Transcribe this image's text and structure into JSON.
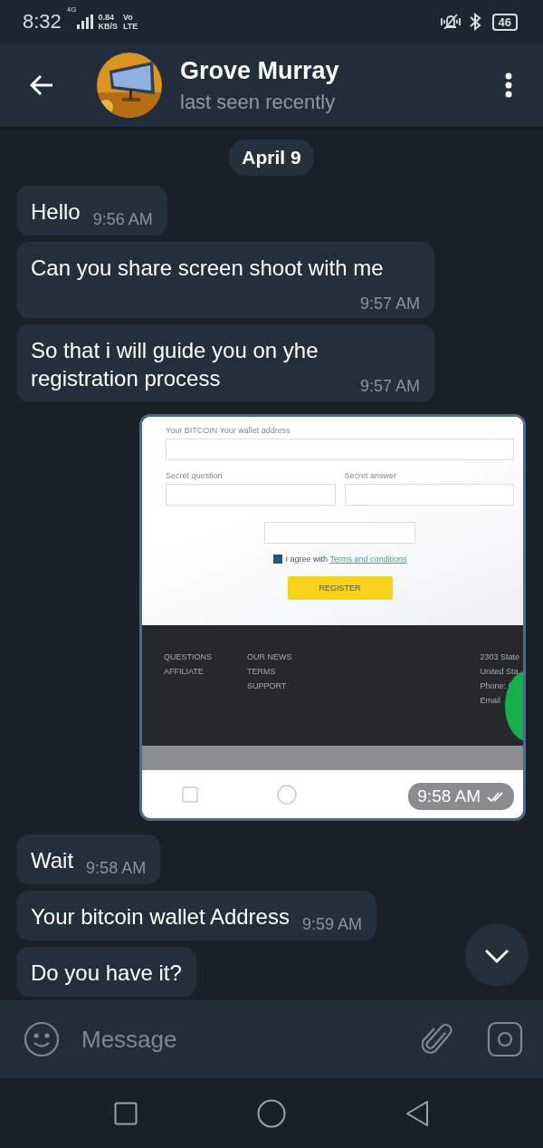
{
  "status_bar": {
    "time": "8:32",
    "network": "4G",
    "speed": "0.84",
    "speed_unit": "KB/S",
    "volte_top": "Vo",
    "volte_bottom": "LTE",
    "battery": "46"
  },
  "header": {
    "name": "Grove Murray",
    "status": "last seen recently"
  },
  "date": "April 9",
  "messages": [
    {
      "kind": "text",
      "text": "Hello",
      "time": "9:56 AM"
    },
    {
      "kind": "text",
      "text": "Can you share screen shoot with me",
      "time": "9:57 AM"
    },
    {
      "kind": "text",
      "text": "So that i will guide you on yhe registration process",
      "time": "9:57 AM"
    },
    {
      "kind": "screenshot",
      "time": "9:58 AM",
      "read": true,
      "form": {
        "wallet_label": "Your BITCOIN Your wallet address",
        "question_label": "Secret question",
        "answer_label": "Secret answer",
        "agree_checked": true,
        "agree_text": "I agree with",
        "terms_link": "Terms and conditions",
        "register": "REGISTER",
        "footer_col_1": [
          "QUESTIONS",
          "AFFILIATE"
        ],
        "footer_col_2": [
          "OUR NEWS",
          "TERMS",
          "SUPPORT"
        ],
        "footer_col_3": [
          "2303 State",
          "United Sta",
          "Phone: (",
          "Email"
        ]
      }
    },
    {
      "kind": "text",
      "text": "Wait",
      "time": "9:58 AM"
    },
    {
      "kind": "text",
      "text": "Your bitcoin wallet Address",
      "time": "9:59 AM"
    },
    {
      "kind": "text",
      "text": "Do you have it?"
    }
  ],
  "composer": {
    "placeholder": "Message"
  }
}
